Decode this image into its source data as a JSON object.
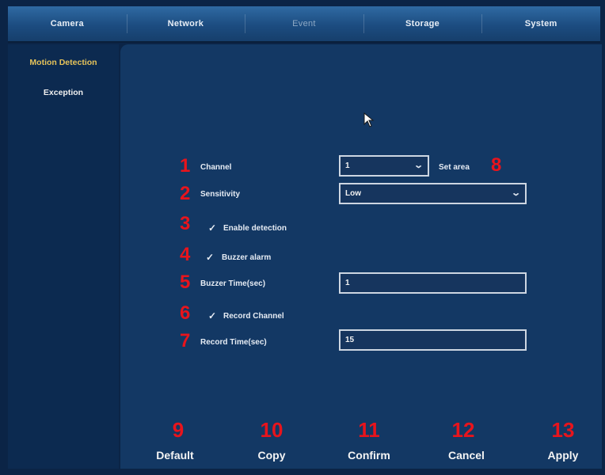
{
  "tabs": [
    "Camera",
    "Network",
    "Event",
    "Storage",
    "System"
  ],
  "sidebar": [
    "Motion Detection",
    "Exception"
  ],
  "form": {
    "channel_label": "Channel",
    "channel_value": "1",
    "set_area": "Set area",
    "sensitivity_label": "Sensitivity",
    "sensitivity_value": "Low",
    "enable_detection": "Enable detection",
    "buzzer_alarm": "Buzzer alarm",
    "buzzer_time_label": "Buzzer Time(sec)",
    "buzzer_time_value": "1",
    "record_channel": "Record Channel",
    "record_time_label": "Record Time(sec)",
    "record_time_value": "15"
  },
  "annotations": [
    "1",
    "2",
    "3",
    "4",
    "5",
    "6",
    "7",
    "8",
    "9",
    "10",
    "11",
    "12",
    "13"
  ],
  "buttons": [
    "Default",
    "Copy",
    "Confirm",
    "Cancel",
    "Apply"
  ],
  "colors": {
    "annotation": "#e8141c",
    "active_sidebar": "#e6c35a",
    "panel": "#133864"
  }
}
